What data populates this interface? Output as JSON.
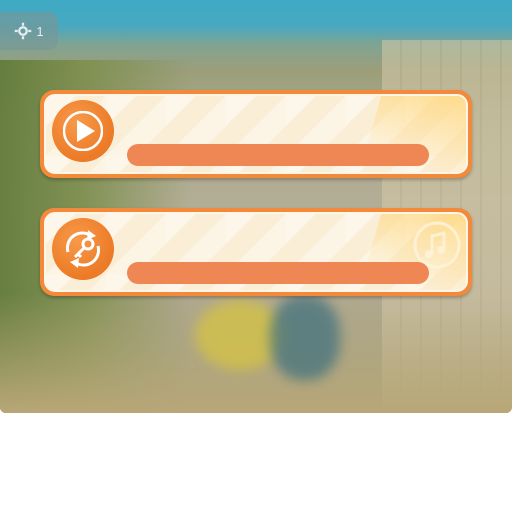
{
  "corner_button": {
    "icon": "settings-icon",
    "text": "1"
  },
  "cards": [
    {
      "icon": "play-icon",
      "progress": 1.0,
      "accent": "#ef8755"
    },
    {
      "icon": "key-refresh-icon",
      "deco_icon": "music-note-icon",
      "progress": 1.0,
      "accent": "#ef8755"
    }
  ],
  "colors": {
    "card_border": "#f3893a",
    "card_fill": "#fbeed6",
    "bar": "#ef8755"
  }
}
